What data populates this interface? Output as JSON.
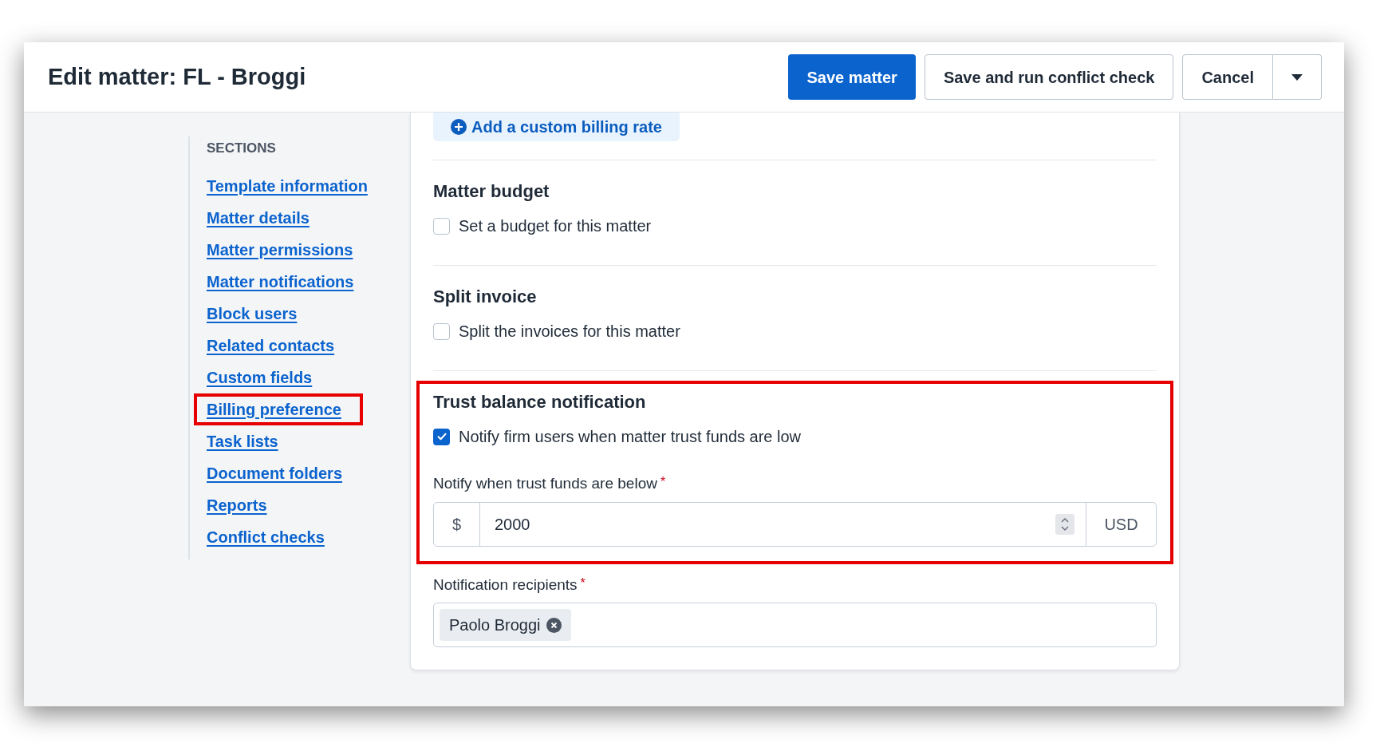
{
  "header": {
    "title": "Edit matter: FL - Broggi",
    "buttons": [
      {
        "label": "Save matter",
        "kind": "primary"
      },
      {
        "label": "Save and run conflict check",
        "kind": "secondary"
      },
      {
        "label": "Cancel",
        "kind": "split"
      }
    ]
  },
  "sidebar": {
    "heading": "SECTIONS",
    "items": [
      {
        "label": "Template information",
        "highlighted": false
      },
      {
        "label": "Matter details",
        "highlighted": false
      },
      {
        "label": "Matter permissions",
        "highlighted": false
      },
      {
        "label": "Matter notifications",
        "highlighted": false
      },
      {
        "label": "Block users",
        "highlighted": false
      },
      {
        "label": "Related contacts",
        "highlighted": false
      },
      {
        "label": "Custom fields",
        "highlighted": false
      },
      {
        "label": "Billing preference",
        "highlighted": true
      },
      {
        "label": "Task lists",
        "highlighted": false
      },
      {
        "label": "Document folders",
        "highlighted": false
      },
      {
        "label": "Reports",
        "highlighted": false
      },
      {
        "label": "Conflict checks",
        "highlighted": false
      }
    ]
  },
  "form": {
    "add_rate_button": "Add a custom billing rate",
    "sections": [
      {
        "title": "Matter budget",
        "highlighted": false,
        "checkbox": {
          "label": "Set a budget for this matter",
          "checked": false
        }
      },
      {
        "title": "Split invoice",
        "highlighted": false,
        "checkbox": {
          "label": "Split the invoices for this matter",
          "checked": false
        }
      },
      {
        "title": "Trust balance notification",
        "highlighted": true,
        "checkbox": {
          "label": "Notify firm users when matter trust funds are low",
          "checked": true
        },
        "amount_field": {
          "label": "Notify when trust funds are below",
          "required_mark": "*",
          "prefix": "$",
          "value": "2000",
          "suffix": "USD"
        }
      }
    ],
    "recipients": {
      "label": "Notification recipients",
      "required_mark": "*",
      "chips": [
        "Paolo Broggi"
      ]
    }
  }
}
